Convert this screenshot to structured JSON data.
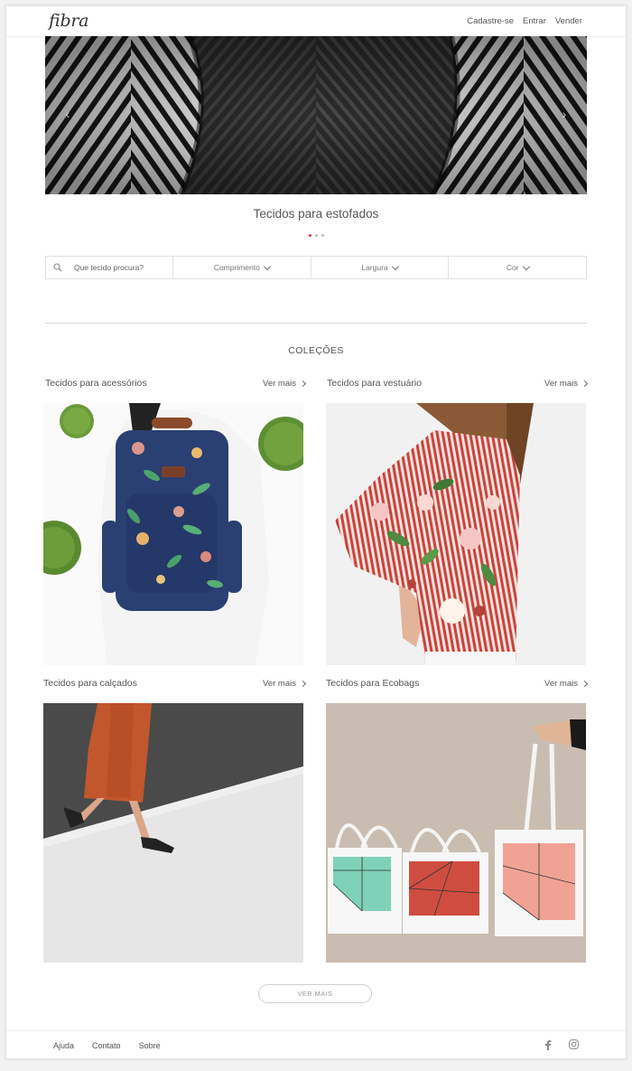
{
  "header": {
    "logo": "fibra",
    "nav": [
      "Cadastre-se",
      "Entrar",
      "Vender"
    ]
  },
  "hero": {
    "caption": "Tecidos para estofados",
    "slide_index": 1,
    "slide_count": 3
  },
  "filters": {
    "search_placeholder": "Que tecido procura?",
    "comprimento": "Comprimento",
    "largura": "Largura",
    "cor": "Cor"
  },
  "collections": {
    "title": "COLEÇÕES",
    "items": [
      {
        "label": "Tecidos para acessórios",
        "more": "Ver mais"
      },
      {
        "label": "Tecidos para vestuário",
        "more": "Ver mais"
      },
      {
        "label": "Tecidos para calçados",
        "more": "Ver mais"
      },
      {
        "label": "Tecidos para Ecobags",
        "more": "Ver mais"
      }
    ]
  },
  "ver_mais_button": "VER MAIS",
  "footer": {
    "links": [
      "Ajuda",
      "Contato",
      "Sobre"
    ]
  },
  "icons": [
    "search-icon",
    "chevron-down-icon",
    "chevron-right-icon",
    "facebook-icon",
    "instagram-icon"
  ]
}
